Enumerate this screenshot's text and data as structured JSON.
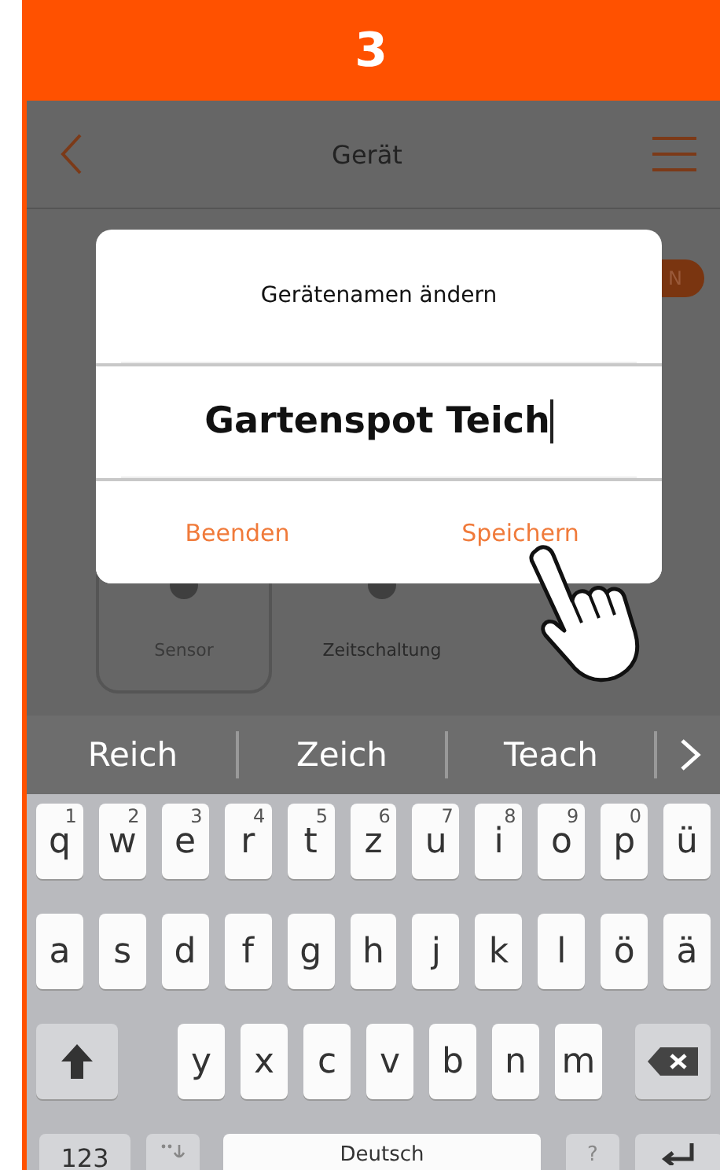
{
  "step": "3",
  "app_bar": {
    "title": "Gerät"
  },
  "power_toggle": {
    "on": true,
    "label": "N"
  },
  "modes": [
    {
      "label": "Sensor",
      "selected": true
    },
    {
      "label": "Zeitschaltung",
      "selected": false
    }
  ],
  "dialog": {
    "title": "Gerätenamen ändern",
    "value": "Gartenspot Teich",
    "buttons": [
      "Beenden",
      "Speichern"
    ]
  },
  "keyboard": {
    "suggestions": [
      "Reich",
      "Zeich",
      "Teach"
    ],
    "rows": [
      [
        {
          "char": "q",
          "hint": "1"
        },
        {
          "char": "w",
          "hint": "2"
        },
        {
          "char": "e",
          "hint": "3"
        },
        {
          "char": "r",
          "hint": "4"
        },
        {
          "char": "t",
          "hint": "5"
        },
        {
          "char": "z",
          "hint": "6"
        },
        {
          "char": "u",
          "hint": "7"
        },
        {
          "char": "i",
          "hint": "8"
        },
        {
          "char": "o",
          "hint": "9"
        },
        {
          "char": "p",
          "hint": "0"
        },
        {
          "char": "ü"
        }
      ],
      [
        {
          "char": "a"
        },
        {
          "char": "s"
        },
        {
          "char": "d"
        },
        {
          "char": "f"
        },
        {
          "char": "g"
        },
        {
          "char": "h"
        },
        {
          "char": "j"
        },
        {
          "char": "k"
        },
        {
          "char": "l"
        },
        {
          "char": "ö"
        },
        {
          "char": "ä"
        }
      ],
      [
        {
          "char": "y"
        },
        {
          "char": "x"
        },
        {
          "char": "c"
        },
        {
          "char": "v"
        },
        {
          "char": "b"
        },
        {
          "char": "n"
        },
        {
          "char": "m"
        }
      ]
    ],
    "numbers_key": "123",
    "space_label": "Deutsch",
    "punct_hint": "?"
  }
}
